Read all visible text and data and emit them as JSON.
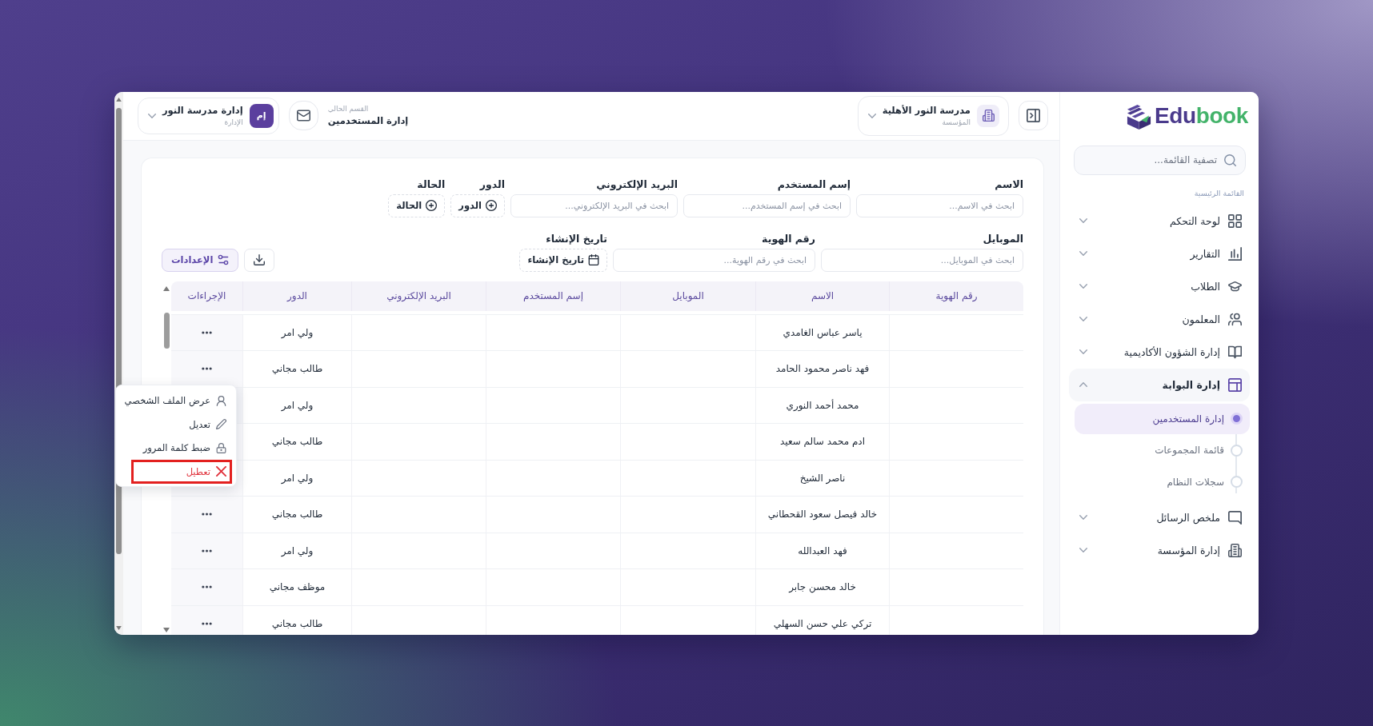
{
  "logo": {
    "text": "Edu",
    "accent_text": "book"
  },
  "sidebar": {
    "search": {
      "placeholder": "تصفية القائمة..."
    },
    "section_title": "القائمة الرئيسية",
    "items": [
      {
        "label": "لوحة التحكم",
        "expanded": false
      },
      {
        "label": "التقارير",
        "expanded": false
      },
      {
        "label": "الطلاب",
        "expanded": false
      },
      {
        "label": "المعلمون",
        "expanded": false
      },
      {
        "label": "إدارة الشؤون الأكاديمية",
        "expanded": false
      },
      {
        "label": "إدارة البوابة",
        "expanded": true,
        "children": [
          {
            "label": "إدارة المستخدمين",
            "selected": true
          },
          {
            "label": "قائمة المجموعات",
            "selected": false
          },
          {
            "label": "سجلات النظام",
            "selected": false
          }
        ]
      },
      {
        "label": "ملخص الرسائل",
        "expanded": false
      },
      {
        "label": "إدارة المؤسسة",
        "expanded": false
      }
    ]
  },
  "header": {
    "institution": {
      "name": "مدرسة النور الأهلية",
      "caption": "المؤسسة"
    },
    "current_section": {
      "caption": "القسم الحالي",
      "title": "إدارة المستخدمين"
    },
    "account": {
      "initials": "إم",
      "name": "إدارة مدرسة النور",
      "role": "الإدارة"
    }
  },
  "filters": {
    "rows": [
      [
        {
          "kind": "text",
          "label": "الاسم",
          "placeholder": "ابحث في الاسم..."
        },
        {
          "kind": "text",
          "label": "إسم المستخدم",
          "placeholder": "ابحث في إسم المستخدم..."
        },
        {
          "kind": "text",
          "label": "البريد الإلكتروني",
          "placeholder": "ابحث في البريد الإلكتروني..."
        },
        {
          "kind": "choice",
          "label": "الدور",
          "button": "الدور"
        },
        {
          "kind": "choice",
          "label": "الحالة",
          "button": "الحالة"
        }
      ],
      [
        {
          "kind": "text",
          "label": "الموبايل",
          "placeholder": "ابحث في الموبايل..."
        },
        {
          "kind": "text",
          "label": "رقم الهوية",
          "placeholder": "ابحث في رقم الهوية..."
        },
        {
          "kind": "date",
          "label": "تاريخ الإنشاء",
          "button": "تاريخ الإنشاء"
        }
      ]
    ],
    "buttons": [
      {
        "kind": "download"
      },
      {
        "kind": "settings",
        "label": "الإعدادات"
      }
    ]
  },
  "table": {
    "columns": [
      {
        "label": "رقم الهوية",
        "kind": "id"
      },
      {
        "label": "الاسم",
        "kind": "name"
      },
      {
        "label": "الموبايل",
        "kind": "mobile"
      },
      {
        "label": "إسم المستخدم",
        "kind": "username"
      },
      {
        "label": "البريد الإلكتروني",
        "kind": "email"
      },
      {
        "label": "الدور",
        "kind": "role"
      },
      {
        "label": "الإجراءات",
        "kind": "actions"
      }
    ],
    "rows": [
      {
        "name": "ياسر عباس الغامدي",
        "role": "ولي امر",
        "menu_open": false
      },
      {
        "name": "فهد ناصر محمود الحامد",
        "role": "طالب مجاني",
        "menu_open": false
      },
      {
        "name": "محمد أحمد النوري",
        "role": "ولي امر",
        "menu_open": true
      },
      {
        "name": "ادم محمد سالم سعيد",
        "role": "طالب مجاني",
        "menu_open": false
      },
      {
        "name": "ناصر الشيخ",
        "role": "ولي امر",
        "menu_open": false
      },
      {
        "name": "خالد فيصل سعود القحطاني",
        "role": "طالب مجاني",
        "menu_open": false
      },
      {
        "name": "فهد العبدالله",
        "role": "ولي امر",
        "menu_open": false
      },
      {
        "name": "خالد محسن جابر",
        "role": "موظف مجاني",
        "menu_open": false
      },
      {
        "name": "تركي علي حسن السهلي",
        "role": "طالب مجاني",
        "menu_open": false
      }
    ],
    "row_menu": {
      "items": [
        {
          "label": "عرض الملف الشخصي",
          "kind": "normal",
          "highlighted": false
        },
        {
          "label": "تعديل",
          "kind": "normal",
          "highlighted": false
        },
        {
          "label": "ضبط كلمة المرور",
          "kind": "normal",
          "highlighted": false
        },
        {
          "label": "تعطيل",
          "kind": "danger",
          "highlighted": true
        }
      ]
    }
  }
}
